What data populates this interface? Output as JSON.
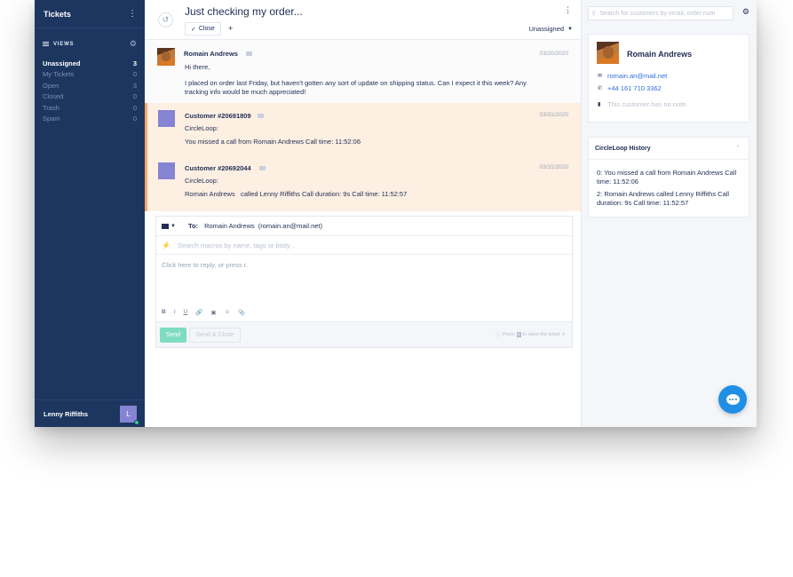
{
  "sidebar": {
    "title": "Tickets",
    "views_label": "VIEWS",
    "views": [
      {
        "label": "Unassigned",
        "count": "3"
      },
      {
        "label": "My Tickets",
        "count": "0"
      },
      {
        "label": "Open",
        "count": "3"
      },
      {
        "label": "Closed",
        "count": "0"
      },
      {
        "label": "Trash",
        "count": "0"
      },
      {
        "label": "Spam",
        "count": "0"
      }
    ],
    "agent_name": "Lenny Riffiths",
    "agent_initial": "L"
  },
  "ticket": {
    "title": "Just checking my order...",
    "close_label": "Close",
    "add_label": "+",
    "assignee": "Unassigned",
    "messages": [
      {
        "author": "Romain Andrews",
        "date": "03/20/2020",
        "greeting": "Hi there,",
        "body": "I placed on order last Friday, but haven't gotten any sort of update on shipping status. Can I expect it this week? Any tracking info would be much appreciated!"
      },
      {
        "author": "Customer #20691809",
        "date": "03/31/2020",
        "source": "CircleLoop:",
        "body": "You missed a call from Romain Andrews Call time: 11:52:06"
      },
      {
        "author": "Customer #20692044",
        "date": "03/31/2020",
        "source": "CircleLoop:",
        "body": "Romain Andrews   called Lenny Riffiths Call duration: 9s Call time: 11:52:57"
      }
    ]
  },
  "reply": {
    "to_label": "To:",
    "to_name": "Romain Andrews",
    "to_email": "(romain.an@mail.net)",
    "macro_placeholder": "Search macros by name, tags or body...",
    "editor_placeholder": "Click here to reply, or press r.",
    "format_tools": [
      "B",
      "I",
      "U",
      "🔗",
      "▣",
      "☺",
      "📎"
    ],
    "send_label": "Send",
    "send_close_label": "Send & Close",
    "hint_prefix": "Press",
    "hint_key": "o",
    "hint_suffix": "to open the ticket",
    "hint_close": "✕"
  },
  "customer": {
    "search_placeholder": "Search for customers by email, order num",
    "name": "Romain Andrews",
    "email": "romain.an@mail.net",
    "phone": "+44 161 710 3362",
    "note_placeholder": "This customer has no note."
  },
  "history": {
    "title": "CircleLoop History",
    "items": [
      "0:  You missed a call from Romain Andrews Call time: 11:52:06",
      "2:  Romain Andrews called Lenny Riffiths Call duration: 9s Call time: 11:52:57"
    ]
  },
  "icons": {
    "history": "history-icon",
    "check": "check-icon",
    "envelope": "envelope-icon",
    "bolt": "bolt-icon",
    "phone": "phone-icon",
    "note": "note-icon",
    "chat": "chat-icon"
  },
  "colors": {
    "sidebar_bg": "#1d3660",
    "accent_orange": "#f7a96b",
    "highlight_bg": "#fdefe2",
    "send_green": "#7fdcc0",
    "avatar_purple": "#8584d3",
    "link_blue": "#2f6ed8",
    "chat_blue": "#1e8fe5"
  }
}
